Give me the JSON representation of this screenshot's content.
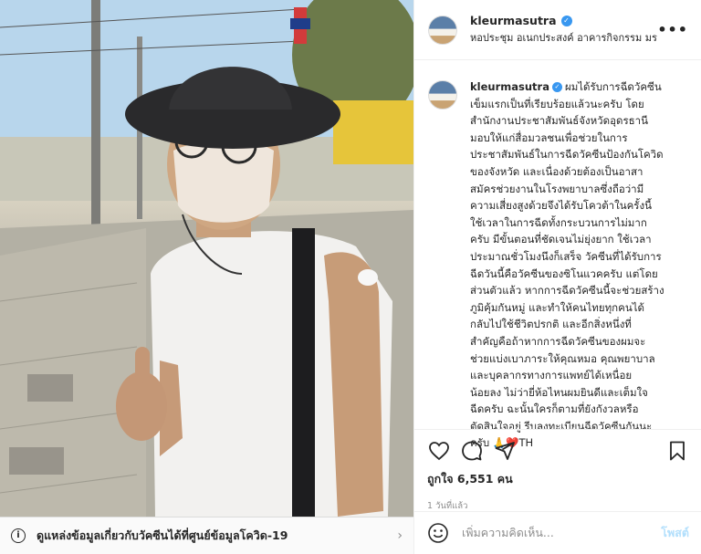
{
  "post": {
    "username": "kleurmasutra",
    "location": "หอประชุม อเนกประสงค์ อาคารกิจกรรม มรภ.อุดร",
    "caption": "ผมได้รับการฉีดวัคซีน\nเข็มแรกเป็นที่เรียบร้อยแล้วนะครับ โดย\nสำนักงานประชาสัมพันธ์จังหวัดอุดรธานี\nมอบให้แก่สื่อมวลชนเพื่อช่วยในการ\nประชาสัมพันธ์ในการฉีดวัคซีนป้องกันโควิด\nของจังหวัด และเนื่องด้วยต้องเป็นอาสา\nสมัครช่วยงานในโรงพยาบาลซึ่งถือว่ามี\nความเสี่ยงสูงด้วยจึงได้รับโควต้าในครั้งนี้\nใช้เวลาในการฉีดทั้งกระบวนการไม่มาก\nครับ มีขั้นตอนที่ชัดเจนไม่ยุ่งยาก ใช้เวลา\nประมาณชั่วโมงนึงก็เสร็จ วัคซีนที่ได้รับการ\nฉีดวันนี้คือวัคซีนของซิโนแวคครับ แต่โดย\nส่วนตัวแล้ว หากการฉีดวัคซีนนี้จะช่วยสร้าง\nภูมิคุ้มกันหมู่ และทำให้คนไทยทุกคนได้\nกลับไปใช้ชีวิตปรกติ และอีกสิ่งหนึ่งที่\nสำคัญคือถ้าหากการฉีดวัคซีนของผมจะ\nช่วยแบ่งเบาภาระให้คุณหมอ คุณพยาบาล\nและบุคลากรทางการแพทย์ได้เหนื่อย\nน้อยลง ไม่ว่ายี่ห้อไหนผมยินดีและเต็มใจ\nฉีดครับ ฉะนั้นใครก็ตามที่ยังกังวลหรือ\nตัดสินใจอยู่ รีบลงทะเบียนฉีดวัคซีนกันนะ\nครับ 🙏❤️TH",
    "likes": "ถูกใจ 6,551 คน",
    "time": "1 วันที่แล้ว"
  },
  "banner": {
    "info_icon": "info-icon",
    "text": "ดูแหล่งข้อมูลเกี่ยวกับวัคซีนได้ที่ศูนย์ข้อมูลโควิด-19",
    "chevron": "›"
  },
  "header": {
    "more": "•••"
  },
  "comment_box": {
    "placeholder": "เพิ่มความคิดเห็น...",
    "post_label": "โพสต์"
  },
  "colors": {
    "verified": "#3897f0",
    "post_disabled": "#b2dffc",
    "muted": "#8e8e8e"
  }
}
